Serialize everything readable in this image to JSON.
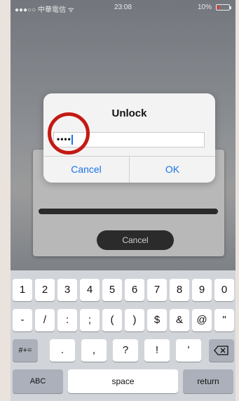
{
  "status_bar": {
    "carrier": "●●●○○ 中華電信 ᯤ",
    "time": "23:08",
    "battery": "10%"
  },
  "background_panel": {
    "cancel_label": "Cancel"
  },
  "dialog": {
    "title": "Unlock",
    "password_value": "••••",
    "cancel_label": "Cancel",
    "ok_label": "OK"
  },
  "keyboard": {
    "row1": [
      "1",
      "2",
      "3",
      "4",
      "5",
      "6",
      "7",
      "8",
      "9",
      "0"
    ],
    "row2": [
      "-",
      "/",
      ":",
      ";",
      "(",
      ")",
      "$",
      "&",
      "@",
      "\""
    ],
    "row3_left": "#+=",
    "row3_middle": [
      ".",
      ",",
      "?",
      "!",
      "'"
    ],
    "backspace_icon": "backspace-icon",
    "row4": {
      "abc": "ABC",
      "space": "space",
      "return": "return"
    }
  },
  "colors": {
    "accent": "#1a73e8",
    "highlight_ring": "#c41a14"
  }
}
